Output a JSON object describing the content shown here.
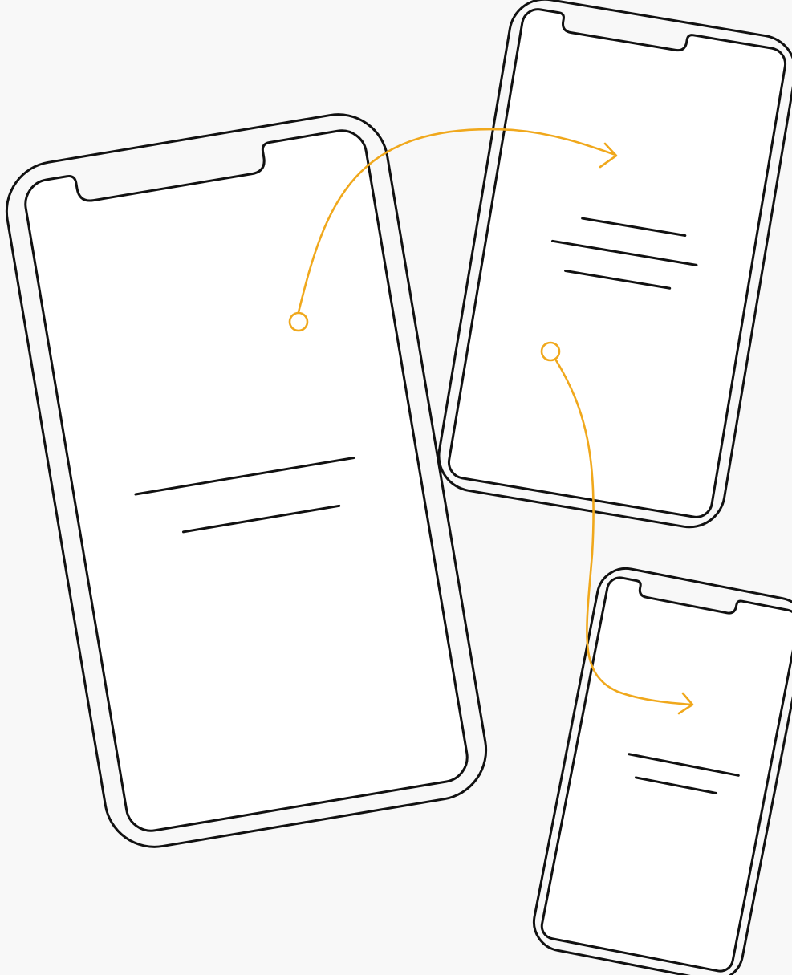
{
  "colors": {
    "background": "#f8f8f8",
    "outline": "#111111",
    "screen": "#ffffff",
    "flow_accent": "#f0a81c"
  },
  "nodes": [
    {
      "id": "phone-large",
      "kind": "smartphone-wireframe",
      "content_lines": 2
    },
    {
      "id": "phone-top-right",
      "kind": "smartphone-wireframe",
      "content_lines": 3
    },
    {
      "id": "phone-bottom-right",
      "kind": "smartphone-wireframe",
      "content_lines": 2
    }
  ],
  "edges": [
    {
      "from": "phone-large",
      "to": "phone-top-right",
      "start_marker": "circle",
      "end_marker": "chevron-arrow"
    },
    {
      "from": "phone-top-right",
      "to": "phone-bottom-right",
      "start_marker": "circle",
      "end_marker": "chevron-arrow"
    }
  ]
}
